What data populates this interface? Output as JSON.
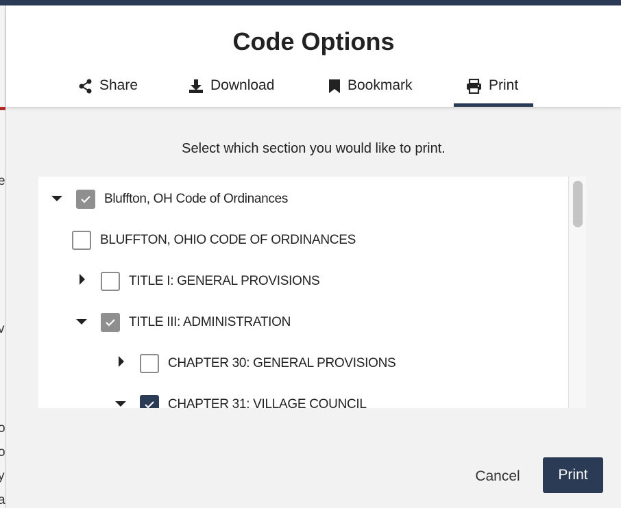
{
  "modal": {
    "title": "Code Options",
    "tabs": [
      {
        "label": "Share",
        "icon": "share-icon"
      },
      {
        "label": "Download",
        "icon": "download-icon"
      },
      {
        "label": "Bookmark",
        "icon": "bookmark-icon"
      },
      {
        "label": "Print",
        "icon": "printer-icon",
        "active": true
      }
    ],
    "instruction": "Select which section you would like to print.",
    "tree": [
      {
        "label": "Bluffton, OH Code of Ordinances",
        "expanded": true,
        "checked": "partial"
      },
      {
        "label": "BLUFFTON, OHIO CODE OF ORDINANCES",
        "checked": false
      },
      {
        "label": "TITLE I: GENERAL PROVISIONS",
        "expanded": false,
        "checked": false
      },
      {
        "label": "TITLE III: ADMINISTRATION",
        "expanded": true,
        "checked": "partial"
      },
      {
        "label": "CHAPTER 30: GENERAL PROVISIONS",
        "expanded": false,
        "checked": false
      },
      {
        "label": "CHAPTER 31: VILLAGE COUNCIL",
        "expanded": true,
        "checked": true
      }
    ],
    "buttons": {
      "cancel": "Cancel",
      "print": "Print"
    }
  },
  "background": {
    "edge_chars": [
      "e",
      "v",
      "o",
      "o",
      "y",
      "a"
    ]
  },
  "colors": {
    "accent": "#2b3a55",
    "checked_gray": "#8f8f8f"
  }
}
